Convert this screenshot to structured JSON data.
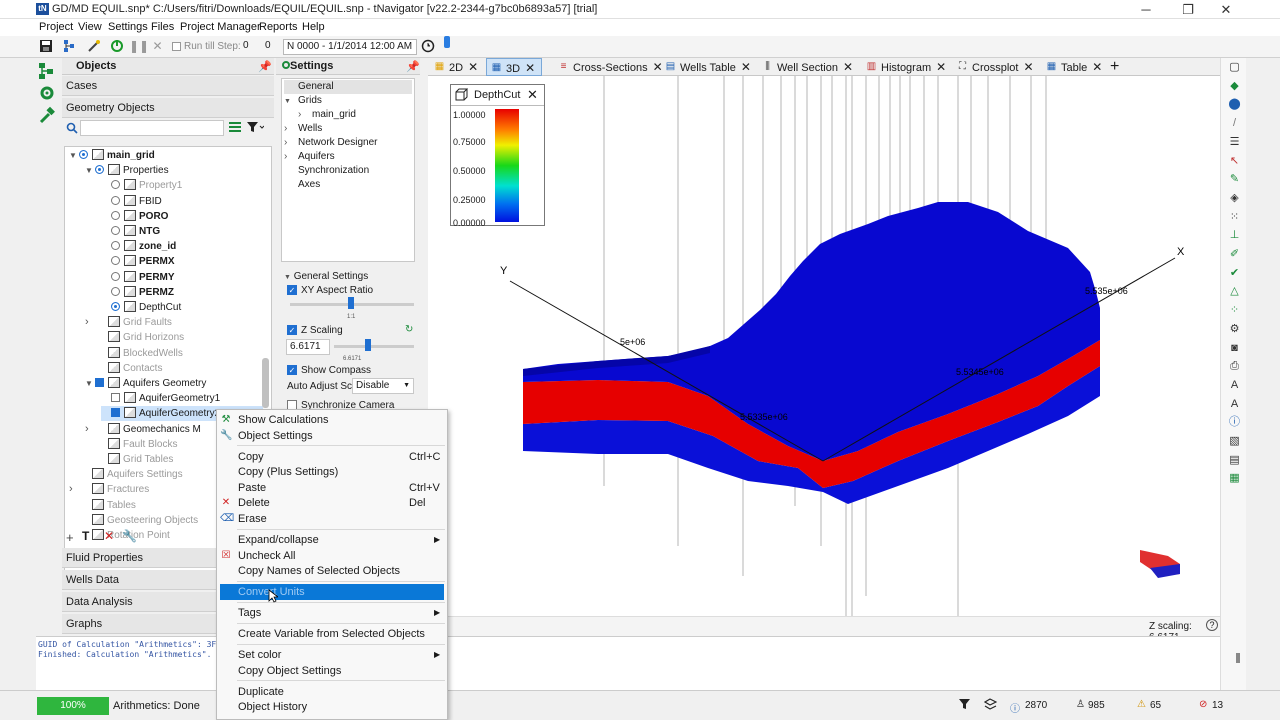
{
  "window": {
    "title": "GD/MD EQUIL.snp* C:/Users/fitri/Downloads/EQUIL/EQUIL.snp - tNavigator [v22.2-2344-g7bc0b6893a57] [trial]",
    "logo": "tN",
    "min_glyph": "─",
    "max_glyph": "❐",
    "close_glyph": "✕"
  },
  "menu": [
    "Project",
    "View",
    "Settings",
    "Files",
    "Project Manager",
    "Reports",
    "Help"
  ],
  "toolbar": {
    "run_till_step_label": "Run till Step:",
    "step_value": "0",
    "second_value": "0",
    "date_value": "N 0000 - 1/1/2014 12:00 AM"
  },
  "objects_panel": {
    "title": "Objects",
    "cases_label": "Cases",
    "geometry_label": "Geometry Objects",
    "search_placeholder": "",
    "tree": [
      {
        "label": "main_grid",
        "indent": 0,
        "expand": "v",
        "check": "radio-on",
        "style": "bold"
      },
      {
        "label": "Properties",
        "indent": 1,
        "expand": "v",
        "check": "radio-on",
        "style": ""
      },
      {
        "label": "Property1",
        "indent": 2,
        "expand": "",
        "check": "radio",
        "style": "dim"
      },
      {
        "label": "FBID",
        "indent": 2,
        "expand": "",
        "check": "radio",
        "style": ""
      },
      {
        "label": "PORO",
        "indent": 2,
        "expand": "",
        "check": "radio",
        "style": "bold"
      },
      {
        "label": "NTG",
        "indent": 2,
        "expand": "",
        "check": "radio",
        "style": "bold"
      },
      {
        "label": "zone_id",
        "indent": 2,
        "expand": "",
        "check": "radio",
        "style": "bold"
      },
      {
        "label": "PERMX",
        "indent": 2,
        "expand": "",
        "check": "radio",
        "style": "bold"
      },
      {
        "label": "PERMY",
        "indent": 2,
        "expand": "",
        "check": "radio",
        "style": "bold"
      },
      {
        "label": "PERMZ",
        "indent": 2,
        "expand": "",
        "check": "radio",
        "style": "bold"
      },
      {
        "label": "DepthCut",
        "indent": 2,
        "expand": "",
        "check": "radio-on",
        "style": ""
      },
      {
        "label": "Grid Faults",
        "indent": 1,
        "expand": ">",
        "check": "",
        "style": "dim"
      },
      {
        "label": "Grid Horizons",
        "indent": 1,
        "expand": "",
        "check": "",
        "style": "dim"
      },
      {
        "label": "BlockedWells",
        "indent": 1,
        "expand": "",
        "check": "",
        "style": "dim"
      },
      {
        "label": "Contacts",
        "indent": 1,
        "expand": "",
        "check": "",
        "style": "dim"
      },
      {
        "label": "Aquifers Geometry",
        "indent": 1,
        "expand": "v",
        "check": "square-on",
        "style": ""
      },
      {
        "label": "AquiferGeometry1",
        "indent": 2,
        "expand": "",
        "check": "square",
        "style": ""
      },
      {
        "label": "AquiferGeometry2",
        "indent": 2,
        "expand": "",
        "check": "square-on",
        "style": "sel"
      },
      {
        "label": "Geomechanics M",
        "indent": 1,
        "expand": ">",
        "check": "",
        "style": ""
      },
      {
        "label": "Fault Blocks",
        "indent": 1,
        "expand": "",
        "check": "",
        "style": "dim"
      },
      {
        "label": "Grid Tables",
        "indent": 1,
        "expand": "",
        "check": "",
        "style": "dim"
      },
      {
        "label": "Aquifers Settings",
        "indent": 0,
        "expand": "",
        "check": "",
        "style": "dim"
      },
      {
        "label": "Fractures",
        "indent": 0,
        "expand": ">",
        "check": "",
        "style": "dim"
      },
      {
        "label": "Tables",
        "indent": 0,
        "expand": "",
        "check": "",
        "style": "dim"
      },
      {
        "label": "Geosteering Objects",
        "indent": 0,
        "expand": "",
        "check": "",
        "style": "dim"
      },
      {
        "label": "Rotation Point",
        "indent": 0,
        "expand": "",
        "check": "",
        "style": "dim"
      }
    ],
    "bottom_sections": [
      "Fluid Properties",
      "Wells Data",
      "Data Analysis",
      "Graphs"
    ]
  },
  "settings_panel": {
    "title": "Settings",
    "tree": [
      {
        "label": "General",
        "indent": 0,
        "expand": "",
        "selected": true
      },
      {
        "label": "Grids",
        "indent": 0,
        "expand": "v",
        "selected": false
      },
      {
        "label": "main_grid",
        "indent": 1,
        "expand": ">",
        "selected": false
      },
      {
        "label": "Wells",
        "indent": 0,
        "expand": ">",
        "selected": false
      },
      {
        "label": "Network Designer",
        "indent": 0,
        "expand": ">",
        "selected": false
      },
      {
        "label": "Aquifers",
        "indent": 0,
        "expand": ">",
        "selected": false
      },
      {
        "label": "Synchronization",
        "indent": 0,
        "expand": "",
        "selected": false
      },
      {
        "label": "Axes",
        "indent": 0,
        "expand": "",
        "selected": false
      }
    ],
    "general_settings_label": "General Settings",
    "xy_aspect_label": "XY Aspect Ratio",
    "xy_aspect_tick": "1:1",
    "z_scaling_label": "Z Scaling",
    "z_scaling_value": "6.6171",
    "z_scaling_tick": "6.6171",
    "show_compass_label": "Show Compass",
    "auto_adjust_label": "Auto Adjust Sc",
    "auto_adjust_value": "Disable",
    "sync_camera_label": "Synchronize Camera"
  },
  "tabs": [
    {
      "label": "2D",
      "icon": "2d-view-icon",
      "active": false
    },
    {
      "label": "3D",
      "icon": "3d-view-icon",
      "active": true
    },
    {
      "label": "Cross-Sections",
      "icon": "cross-section-icon",
      "active": false
    },
    {
      "label": "Wells Table",
      "icon": "wells-table-icon",
      "active": false
    },
    {
      "label": "Well Section",
      "icon": "well-section-icon",
      "active": false
    },
    {
      "label": "Histogram",
      "icon": "histogram-icon",
      "active": false
    },
    {
      "label": "Crossplot",
      "icon": "crossplot-icon",
      "active": false
    },
    {
      "label": "Table",
      "icon": "table-icon",
      "active": false
    }
  ],
  "viewport": {
    "legend_title": "DepthCut",
    "legend_ticks": [
      "1.00000",
      "0.75000",
      "0.50000",
      "0.25000",
      "0.00000"
    ],
    "axis_x_label": "X",
    "axis_y_label": "Y",
    "axis_labels": [
      "5e+06",
      "5.535e+06",
      "5.5345e+06",
      "5.5335e+06"
    ],
    "z_scaling_status": "Z scaling: 6.6171",
    "colors": {
      "high": "#e00000",
      "low": "#0a10d8",
      "edge": "#0505a8"
    }
  },
  "log": [
    "GUID of Calculation \"Arithmetics\": 3F299",
    "Finished: Calculation \"Arithmetics\". Ela"
  ],
  "status": {
    "progress_percent": "100%",
    "progress_fraction": 1.0,
    "message": "Arithmetics: Done",
    "count1": "2870",
    "count2": "985",
    "count3": "65",
    "count4": "13"
  },
  "context_menu": [
    {
      "label": "Show Calculations",
      "shortcut": "",
      "submenu": false,
      "icon": "calculations-icon",
      "sep_after": false,
      "highlighted": false
    },
    {
      "label": "Object Settings",
      "shortcut": "",
      "submenu": false,
      "icon": "wrench-icon",
      "sep_after": true,
      "highlighted": false
    },
    {
      "label": "Copy",
      "shortcut": "Ctrl+C",
      "submenu": false,
      "icon": "",
      "sep_after": false,
      "highlighted": false
    },
    {
      "label": "Copy (Plus Settings)",
      "shortcut": "",
      "submenu": false,
      "icon": "",
      "sep_after": false,
      "highlighted": false
    },
    {
      "label": "Paste",
      "shortcut": "Ctrl+V",
      "submenu": false,
      "icon": "",
      "sep_after": false,
      "highlighted": false
    },
    {
      "label": "Delete",
      "shortcut": "Del",
      "submenu": false,
      "icon": "delete-x-icon",
      "sep_after": false,
      "highlighted": false
    },
    {
      "label": "Erase",
      "shortcut": "",
      "submenu": false,
      "icon": "eraser-icon",
      "sep_after": true,
      "highlighted": false
    },
    {
      "label": "Expand/collapse",
      "shortcut": "",
      "submenu": true,
      "icon": "",
      "sep_after": false,
      "highlighted": false
    },
    {
      "label": "Uncheck All",
      "shortcut": "",
      "submenu": false,
      "icon": "uncheck-icon",
      "sep_after": false,
      "highlighted": false
    },
    {
      "label": "Copy Names of Selected Objects",
      "shortcut": "",
      "submenu": false,
      "icon": "",
      "sep_after": true,
      "highlighted": false
    },
    {
      "label": "Convert Units",
      "shortcut": "",
      "submenu": false,
      "icon": "",
      "sep_after": true,
      "highlighted": true
    },
    {
      "label": "Tags",
      "shortcut": "",
      "submenu": true,
      "icon": "",
      "sep_after": true,
      "highlighted": false
    },
    {
      "label": "Create Variable from Selected Objects",
      "shortcut": "",
      "submenu": false,
      "icon": "",
      "sep_after": true,
      "highlighted": false
    },
    {
      "label": "Set color",
      "shortcut": "",
      "submenu": true,
      "icon": "",
      "sep_after": false,
      "highlighted": false
    },
    {
      "label": "Copy Object Settings",
      "shortcut": "",
      "submenu": false,
      "icon": "",
      "sep_after": true,
      "highlighted": false
    },
    {
      "label": "Duplicate",
      "shortcut": "",
      "submenu": false,
      "icon": "",
      "sep_after": false,
      "highlighted": false
    },
    {
      "label": "Object History",
      "shortcut": "",
      "submenu": false,
      "icon": "",
      "sep_after": false,
      "highlighted": false
    }
  ]
}
